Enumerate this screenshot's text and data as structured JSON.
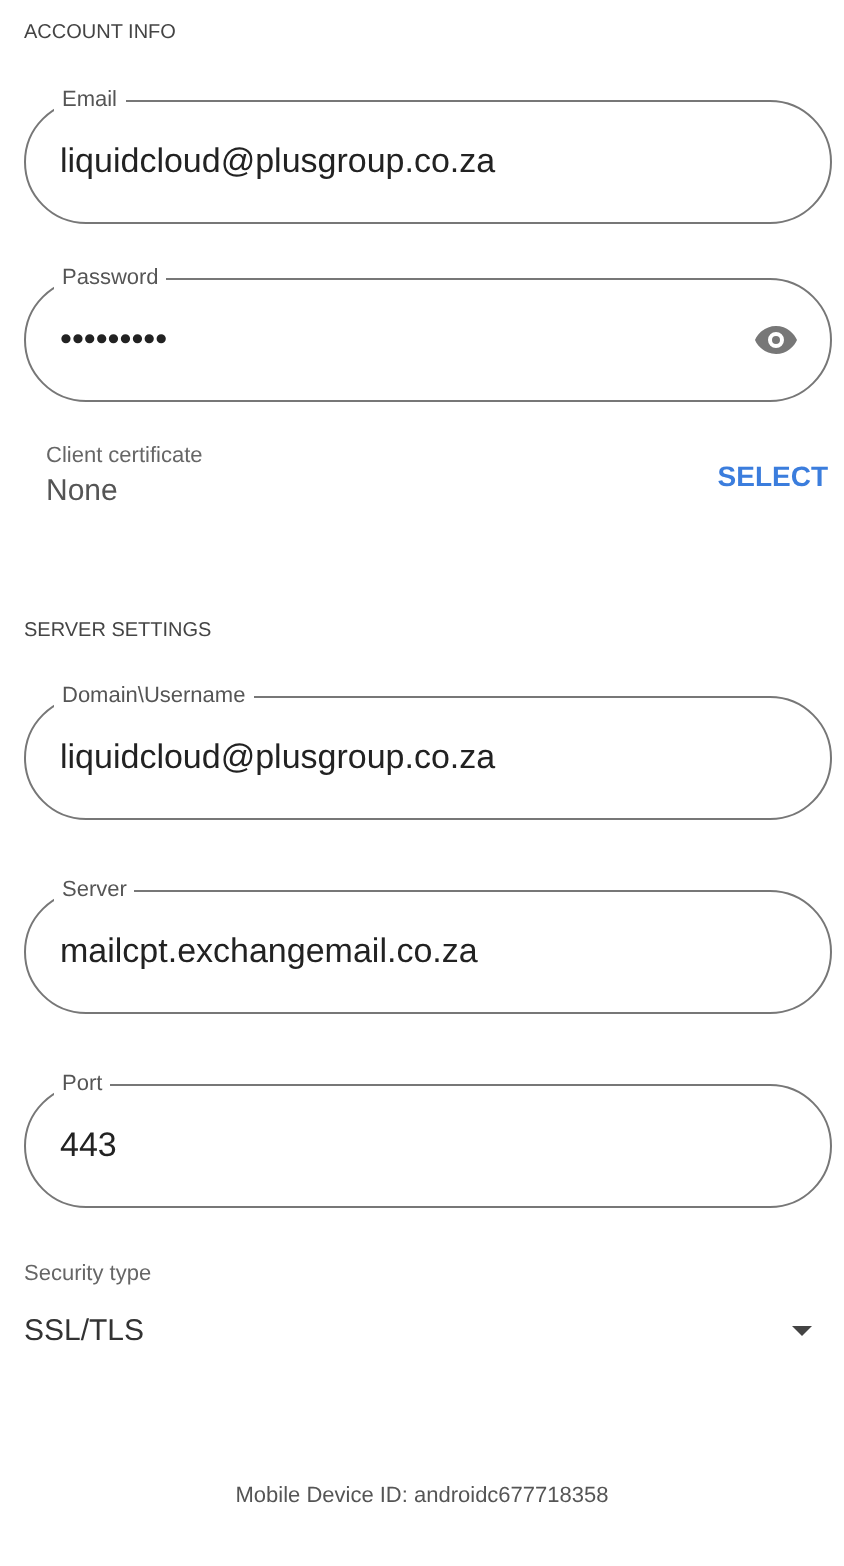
{
  "account_info": {
    "heading": "ACCOUNT INFO",
    "fields": [
      {
        "kind": "text",
        "label": "Email",
        "value": "liquidcloud@plusgroup.co.za"
      },
      {
        "kind": "password",
        "label": "Password",
        "value": "•••••••••"
      }
    ],
    "client_certificate": {
      "label": "Client certificate",
      "value": "None",
      "action": "SELECT"
    }
  },
  "server_settings": {
    "heading": "SERVER SETTINGS",
    "fields": [
      {
        "kind": "text",
        "label": "Domain\\Username",
        "value": "liquidcloud@plusgroup.co.za"
      },
      {
        "kind": "text",
        "label": "Server",
        "value": "mailcpt.exchangemail.co.za"
      },
      {
        "kind": "text",
        "label": "Port",
        "value": "443"
      }
    ],
    "security_type": {
      "label": "Security type",
      "value": "SSL/TLS"
    }
  },
  "footer": "Mobile Device ID: androidc677718358"
}
